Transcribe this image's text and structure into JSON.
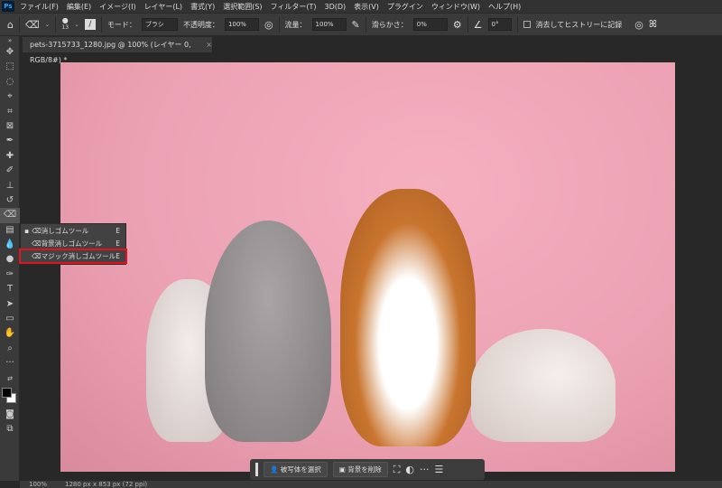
{
  "menu": {
    "logo": "Ps",
    "items": [
      "ファイル(F)",
      "編集(E)",
      "イメージ(I)",
      "レイヤー(L)",
      "書式(Y)",
      "選択範囲(S)",
      "フィルター(T)",
      "3D(D)",
      "表示(V)",
      "プラグイン",
      "ウィンドウ(W)",
      "ヘルプ(H)"
    ]
  },
  "options": {
    "brush_size": "13",
    "mode_label": "モード：",
    "mode_value": "ブラシ",
    "opacity_label": "不透明度：",
    "opacity_value": "100%",
    "flow_label": "流量：",
    "flow_value": "100%",
    "smoothing_label": "滑らかさ：",
    "smoothing_value": "0%",
    "angle_value": "0°",
    "history_label": "消去してヒストリーに記録"
  },
  "tab": {
    "title": "pets-3715733_1280.jpg @ 100% (レイヤー 0, RGB/8#) *",
    "close": "×"
  },
  "flyout": {
    "items": [
      {
        "label": "消しゴムツール",
        "key": "E"
      },
      {
        "label": "背景消しゴムツール",
        "key": "E"
      },
      {
        "label": "マジック消しゴムツール",
        "key": "E"
      }
    ]
  },
  "contextbar": {
    "select_subject": "被写体を選択",
    "remove_bg": "背景を削除",
    "more": "···"
  },
  "status": {
    "zoom": "100%",
    "dimensions": "1280 px x 853 px (72 ppi)"
  },
  "colors": {
    "highlight": "#e0141e",
    "canvas_bg": "#f0a8b8"
  }
}
